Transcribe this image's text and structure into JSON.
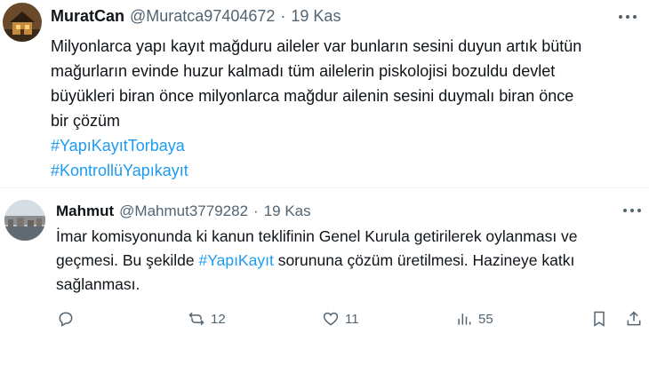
{
  "tweets": [
    {
      "name": "MuratCan",
      "handle": "@Muratca97404672",
      "separator": "·",
      "date": "19 Kas",
      "lines": [
        "Milyonlarca yapı kayıt mağduru aileler var bunların sesini duyun artık bütün",
        "mağurların evinde huzur kalmadı tüm ailelerin piskolojisi bozuldu devlet",
        "büyükleri biran önce milyonlarca mağdur ailenin sesini duymalı biran önce",
        "bir çözüm"
      ],
      "hashtags": [
        "#YapıKayıtTorbaya",
        "#KontrollüYapıkayıt"
      ]
    },
    {
      "name": "Mahmut",
      "handle": "@Mahmut3779282",
      "separator": "·",
      "date": "19 Kas",
      "line1": "İmar komisyonunda ki kanun teklifinin Genel Kurula getirilerek oylanması ve",
      "line2_before": "geçmesi. Bu şekilde ",
      "line2_tag": "#YapıKayıt",
      "line2_after": " sorununa çözüm üretilmesi. Hazineye katkı",
      "line3": "sağlanması."
    }
  ],
  "actions": {
    "reply_icon": "reply-icon",
    "retweet_icon": "retweet-icon",
    "retweet_count": "12",
    "like_icon": "heart-icon",
    "like_count": "11",
    "views_icon": "views-icon",
    "views_count": "55",
    "bookmark_icon": "bookmark-icon",
    "share_icon": "share-icon"
  },
  "colors": {
    "link": "#1d9bf0",
    "secondary_text": "#536471",
    "text": "#0f1419"
  }
}
